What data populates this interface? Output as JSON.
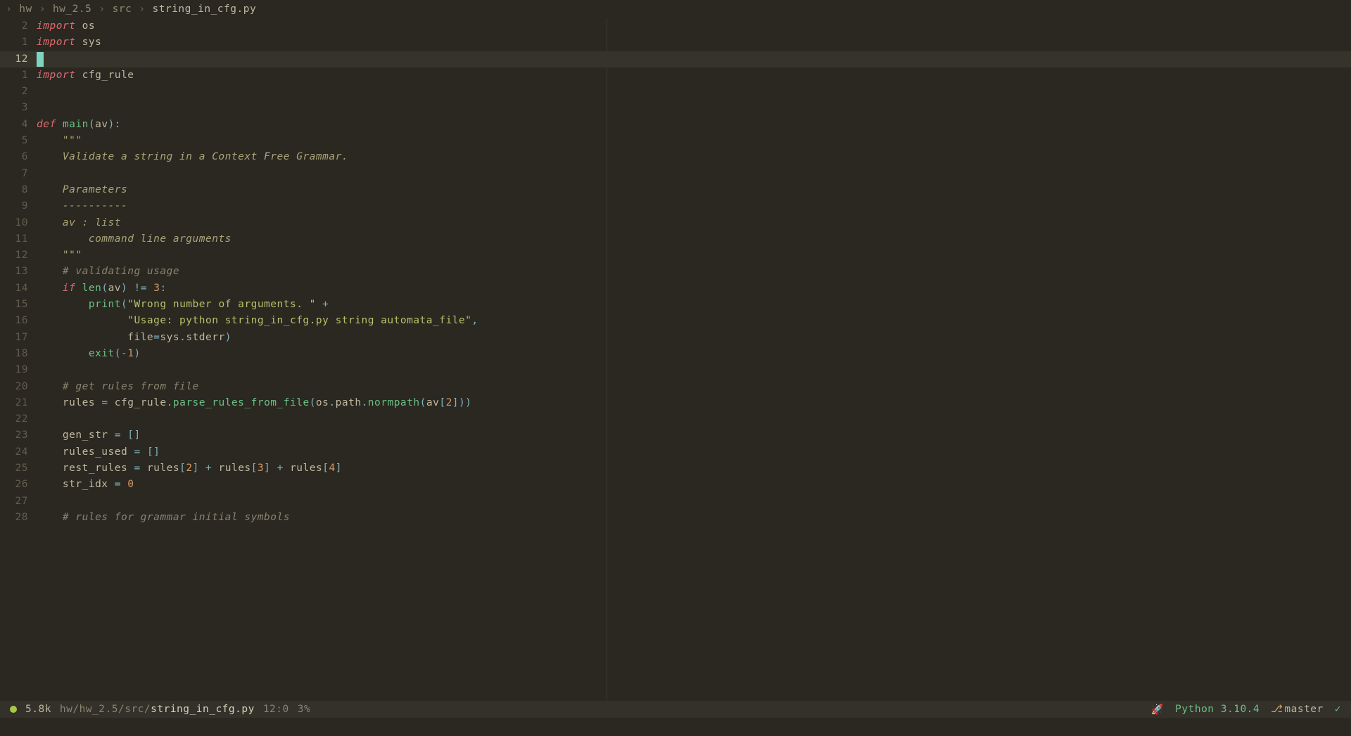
{
  "breadcrumb": {
    "items": [
      "hw",
      "hw_2.5",
      "src",
      "string_in_cfg.py"
    ]
  },
  "lines": [
    {
      "num": "2",
      "tokens": [
        {
          "t": "import",
          "c": "kw"
        },
        {
          "t": " ",
          "c": ""
        },
        {
          "t": "os",
          "c": "var"
        }
      ]
    },
    {
      "num": "1",
      "tokens": [
        {
          "t": "import",
          "c": "kw"
        },
        {
          "t": " ",
          "c": ""
        },
        {
          "t": "sys",
          "c": "var"
        }
      ]
    },
    {
      "num": "12",
      "current": true,
      "cursor": true,
      "tokens": []
    },
    {
      "num": "1",
      "tokens": [
        {
          "t": "import",
          "c": "kw"
        },
        {
          "t": " ",
          "c": ""
        },
        {
          "t": "cfg_rule",
          "c": "var"
        }
      ]
    },
    {
      "num": "2",
      "tokens": []
    },
    {
      "num": "3",
      "tokens": []
    },
    {
      "num": "4",
      "tokens": [
        {
          "t": "def",
          "c": "kw-def"
        },
        {
          "t": " ",
          "c": ""
        },
        {
          "t": "main",
          "c": "fn"
        },
        {
          "t": "(",
          "c": "punc"
        },
        {
          "t": "av",
          "c": "var"
        },
        {
          "t": ")",
          "c": "punc"
        },
        {
          "t": ":",
          "c": "punc"
        }
      ]
    },
    {
      "num": "5",
      "tokens": [
        {
          "t": "    \"\"\"",
          "c": "doc"
        }
      ]
    },
    {
      "num": "6",
      "tokens": [
        {
          "t": "    Validate a string in a Context Free Grammar.",
          "c": "doc"
        }
      ]
    },
    {
      "num": "7",
      "tokens": []
    },
    {
      "num": "8",
      "tokens": [
        {
          "t": "    Parameters",
          "c": "doc"
        }
      ]
    },
    {
      "num": "9",
      "tokens": [
        {
          "t": "    ----------",
          "c": "doc"
        }
      ]
    },
    {
      "num": "10",
      "tokens": [
        {
          "t": "    av : list",
          "c": "doc"
        }
      ]
    },
    {
      "num": "11",
      "tokens": [
        {
          "t": "        command line arguments",
          "c": "doc"
        }
      ]
    },
    {
      "num": "12",
      "tokens": [
        {
          "t": "    \"\"\"",
          "c": "doc"
        }
      ]
    },
    {
      "num": "13",
      "tokens": [
        {
          "t": "    # validating usage",
          "c": "comment"
        }
      ]
    },
    {
      "num": "14",
      "tokens": [
        {
          "t": "    ",
          "c": ""
        },
        {
          "t": "if",
          "c": "kw"
        },
        {
          "t": " ",
          "c": ""
        },
        {
          "t": "len",
          "c": "fn"
        },
        {
          "t": "(",
          "c": "punc"
        },
        {
          "t": "av",
          "c": "var"
        },
        {
          "t": ")",
          "c": "punc"
        },
        {
          "t": " ",
          "c": ""
        },
        {
          "t": "!=",
          "c": "op"
        },
        {
          "t": " ",
          "c": ""
        },
        {
          "t": "3",
          "c": "num"
        },
        {
          "t": ":",
          "c": "punc"
        }
      ]
    },
    {
      "num": "15",
      "tokens": [
        {
          "t": "        ",
          "c": ""
        },
        {
          "t": "print",
          "c": "fn"
        },
        {
          "t": "(",
          "c": "punc"
        },
        {
          "t": "\"Wrong number of arguments. \"",
          "c": "str"
        },
        {
          "t": " ",
          "c": ""
        },
        {
          "t": "+",
          "c": "op"
        }
      ]
    },
    {
      "num": "16",
      "tokens": [
        {
          "t": "              ",
          "c": ""
        },
        {
          "t": "\"Usage: python string_in_cfg.py string automata_file\"",
          "c": "str"
        },
        {
          "t": ",",
          "c": "punc"
        }
      ]
    },
    {
      "num": "17",
      "tokens": [
        {
          "t": "              ",
          "c": ""
        },
        {
          "t": "file",
          "c": "var"
        },
        {
          "t": "=",
          "c": "op"
        },
        {
          "t": "sys",
          "c": "var"
        },
        {
          "t": ".",
          "c": "punc"
        },
        {
          "t": "stderr",
          "c": "attr"
        },
        {
          "t": ")",
          "c": "punc"
        }
      ]
    },
    {
      "num": "18",
      "tokens": [
        {
          "t": "        ",
          "c": ""
        },
        {
          "t": "exit",
          "c": "fn"
        },
        {
          "t": "(",
          "c": "punc"
        },
        {
          "t": "-",
          "c": "op"
        },
        {
          "t": "1",
          "c": "num"
        },
        {
          "t": ")",
          "c": "punc"
        }
      ]
    },
    {
      "num": "19",
      "tokens": []
    },
    {
      "num": "20",
      "tokens": [
        {
          "t": "    # get rules from file",
          "c": "comment"
        }
      ]
    },
    {
      "num": "21",
      "tokens": [
        {
          "t": "    ",
          "c": ""
        },
        {
          "t": "rules",
          "c": "var"
        },
        {
          "t": " ",
          "c": ""
        },
        {
          "t": "=",
          "c": "op"
        },
        {
          "t": " ",
          "c": ""
        },
        {
          "t": "cfg_rule",
          "c": "var"
        },
        {
          "t": ".",
          "c": "punc"
        },
        {
          "t": "parse_rules_from_file",
          "c": "fn"
        },
        {
          "t": "(",
          "c": "punc"
        },
        {
          "t": "os",
          "c": "var"
        },
        {
          "t": ".",
          "c": "punc"
        },
        {
          "t": "path",
          "c": "attr"
        },
        {
          "t": ".",
          "c": "punc"
        },
        {
          "t": "normpath",
          "c": "fn"
        },
        {
          "t": "(",
          "c": "punc"
        },
        {
          "t": "av",
          "c": "var"
        },
        {
          "t": "[",
          "c": "punc"
        },
        {
          "t": "2",
          "c": "num"
        },
        {
          "t": "]",
          "c": "punc"
        },
        {
          "t": "))",
          "c": "punc"
        }
      ]
    },
    {
      "num": "22",
      "tokens": []
    },
    {
      "num": "23",
      "tokens": [
        {
          "t": "    ",
          "c": ""
        },
        {
          "t": "gen_str",
          "c": "var"
        },
        {
          "t": " ",
          "c": ""
        },
        {
          "t": "=",
          "c": "op"
        },
        {
          "t": " ",
          "c": ""
        },
        {
          "t": "[]",
          "c": "punc"
        }
      ]
    },
    {
      "num": "24",
      "tokens": [
        {
          "t": "    ",
          "c": ""
        },
        {
          "t": "rules_used",
          "c": "var"
        },
        {
          "t": " ",
          "c": ""
        },
        {
          "t": "=",
          "c": "op"
        },
        {
          "t": " ",
          "c": ""
        },
        {
          "t": "[]",
          "c": "punc"
        }
      ]
    },
    {
      "num": "25",
      "tokens": [
        {
          "t": "    ",
          "c": ""
        },
        {
          "t": "rest_rules",
          "c": "var"
        },
        {
          "t": " ",
          "c": ""
        },
        {
          "t": "=",
          "c": "op"
        },
        {
          "t": " ",
          "c": ""
        },
        {
          "t": "rules",
          "c": "var"
        },
        {
          "t": "[",
          "c": "punc"
        },
        {
          "t": "2",
          "c": "num"
        },
        {
          "t": "]",
          "c": "punc"
        },
        {
          "t": " ",
          "c": ""
        },
        {
          "t": "+",
          "c": "op"
        },
        {
          "t": " ",
          "c": ""
        },
        {
          "t": "rules",
          "c": "var"
        },
        {
          "t": "[",
          "c": "punc"
        },
        {
          "t": "3",
          "c": "num"
        },
        {
          "t": "]",
          "c": "punc"
        },
        {
          "t": " ",
          "c": ""
        },
        {
          "t": "+",
          "c": "op"
        },
        {
          "t": " ",
          "c": ""
        },
        {
          "t": "rules",
          "c": "var"
        },
        {
          "t": "[",
          "c": "punc"
        },
        {
          "t": "4",
          "c": "num"
        },
        {
          "t": "]",
          "c": "punc"
        }
      ]
    },
    {
      "num": "26",
      "tokens": [
        {
          "t": "    ",
          "c": ""
        },
        {
          "t": "str_idx",
          "c": "var"
        },
        {
          "t": " ",
          "c": ""
        },
        {
          "t": "=",
          "c": "op"
        },
        {
          "t": " ",
          "c": ""
        },
        {
          "t": "0",
          "c": "num"
        }
      ]
    },
    {
      "num": "27",
      "tokens": []
    },
    {
      "num": "28",
      "tokens": [
        {
          "t": "    # rules for grammar initial symbols",
          "c": "comment"
        }
      ]
    }
  ],
  "status": {
    "size": "5.8k",
    "path_dim": "hw/hw_2.5/src/",
    "path_bright": "string_in_cfg.py",
    "cursor": "12:0",
    "percent": "3%",
    "python": "Python 3.10.4",
    "branch": "master"
  }
}
